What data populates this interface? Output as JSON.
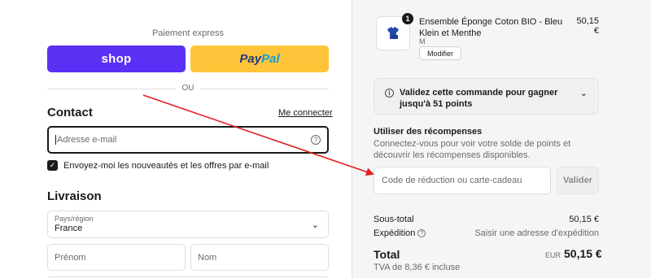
{
  "express": {
    "title": "Paiement express",
    "shop_label": "shop",
    "paypal_pay": "Pay",
    "paypal_pal": "Pal",
    "divider": "OU"
  },
  "contact": {
    "heading": "Contact",
    "login_link": "Me connecter",
    "email_placeholder": "Adresse e-mail",
    "newsletter": "Envoyez-moi les nouveautés et les offres par e-mail",
    "newsletter_checked": true
  },
  "delivery": {
    "heading": "Livraison",
    "country_label": "Pays/région",
    "country_value": "France",
    "first_name_placeholder": "Prénom",
    "last_name_placeholder": "Nom"
  },
  "cart": {
    "quantity": "1",
    "product_name": "Ensemble Éponge Coton BIO - Bleu Klein et Menthe",
    "variant": "M",
    "modify_label": "Modifier",
    "price": "50,15 €"
  },
  "promo": {
    "text": "Validez cette commande pour gagner jusqu'à 51 points"
  },
  "rewards": {
    "title": "Utiliser des récompenses",
    "description": "Connectez-vous pour voir votre solde de points et découvrir les récompenses disponibles.",
    "code_placeholder": "Code de réduction ou carte-cadeau",
    "apply_label": "Valider"
  },
  "summary": {
    "subtotal_label": "Sous-total",
    "subtotal_value": "50,15 €",
    "shipping_label": "Expédition",
    "shipping_value": "Saisir une adresse d'expédition",
    "total_label": "Total",
    "total_currency": "EUR",
    "total_value": "50,15 €",
    "tax_note": "TVA de 8,36 € incluse"
  },
  "colors": {
    "shop_purple": "#5a31f4",
    "paypal_yellow": "#ffc439",
    "annotation_arrow": "#e21f1f"
  }
}
